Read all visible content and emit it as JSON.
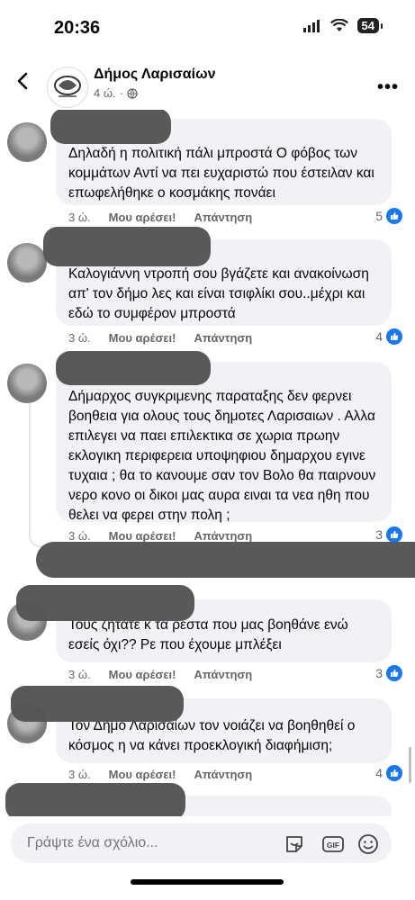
{
  "status": {
    "time": "20:36",
    "battery": "54"
  },
  "header": {
    "title": "Δήμος Λαρισαίων",
    "time_ago": "4 ώ."
  },
  "comments": [
    {
      "text": "Δηλαδή η πολιτική πάλι μπροστά Ο φόβος των κομμάτων Αντί να πει ευχαριστώ που έστειλαν και επωφελήθηκε  ο κοσμάκης πονάει",
      "time": "3 ώ.",
      "like": "Μου αρέσει!",
      "reply": "Απάντηση",
      "reactions": "5"
    },
    {
      "text": "Καλογιάννη ντροπή σου βγάζετε και ανακοίνωση απ' τον δήμο λες και είναι τσιφλίκι σου..μέχρι και εδώ το συμφέρον μπροστά",
      "time": "3 ώ.",
      "like": "Μου αρέσει!",
      "reply": "Απάντηση",
      "reactions": "4"
    },
    {
      "text": "Δήμαρχος συγκριμενης παραταξης δεν φερνει βοηθεια για ολους τους δημοτες Λαρισαιων . Αλλα επιλεγει να παει επιλεκτικα σε χωρια πρωην εκλογικη περιφερεια υποψηφιου δημαρχου εγινε τυχαια ; θα το κανουμε σαν τον Βολο θα παιρνουν νερο κονο οι δικοι μας αυρα ειναι τα νεα ηθη που θελει να φερει στην πολη ;",
      "time": "3 ώ.",
      "like": "Μου αρέσει!",
      "reply": "Απάντηση",
      "reactions": "3"
    },
    {
      "text": "Τους ζητάτε κ τα ρέστα που μας βοηθάνε ενώ εσείς όχι?? Ρε που έχουμε μπλέξει",
      "time": "3 ώ.",
      "like": "Μου αρέσει!",
      "reply": "Απάντηση",
      "reactions": "3"
    },
    {
      "text": "Τον Δήμο Λαρισαίων τον νοιάζει να βοηθηθεί ο κόσμος η να κάνει προεκλογική διαφήμιση;",
      "time": "3 ώ.",
      "like": "Μου αρέσει!",
      "reply": "Απάντηση",
      "reactions": "4"
    }
  ],
  "compose": {
    "placeholder": "Γράψτε ένα σχόλιο..."
  },
  "colors": {
    "accent": "#1877f2",
    "bubble": "#f0f2f5",
    "meta": "#65676b"
  },
  "icons": [
    "back-arrow-icon",
    "more-icon",
    "globe-icon",
    "like-icon",
    "sticker-icon",
    "gif-icon",
    "emoji-icon"
  ]
}
